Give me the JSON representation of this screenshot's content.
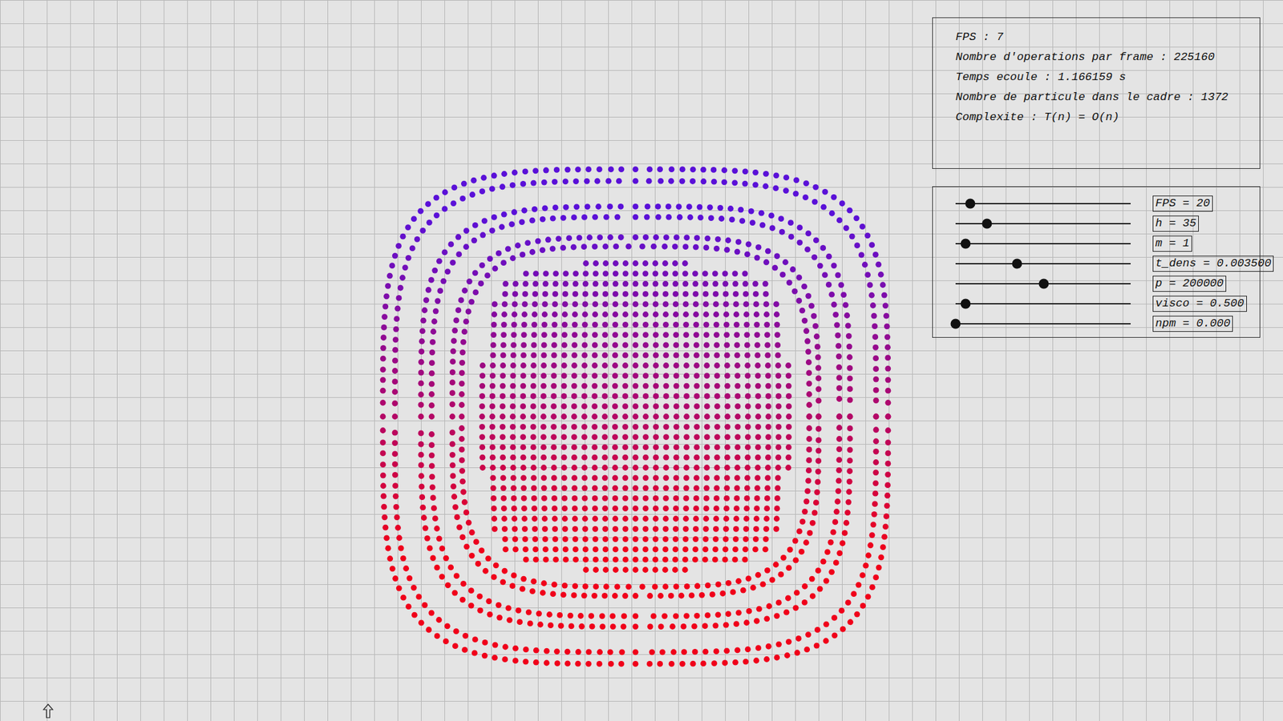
{
  "info": {
    "lines": [
      "FPS : 7",
      "Nombre d'operations par frame : 225160",
      "Temps ecoule : 1.166159 s",
      "Nombre de particule dans le cadre : 1372",
      "Complexite : T(n) = O(n)"
    ]
  },
  "sliders": [
    {
      "label": "FPS = 20",
      "level": 0.084
    },
    {
      "label": "h = 35",
      "level": 0.178
    },
    {
      "label": "m = 1",
      "level": 0.056
    },
    {
      "label": "t_dens = 0.003500",
      "level": 0.35
    },
    {
      "label": "p = 200000",
      "level": 0.505
    },
    {
      "label": "visco = 0.500",
      "level": 0.056
    },
    {
      "label": "npm = 0.000",
      "level": 0.0
    }
  ]
}
